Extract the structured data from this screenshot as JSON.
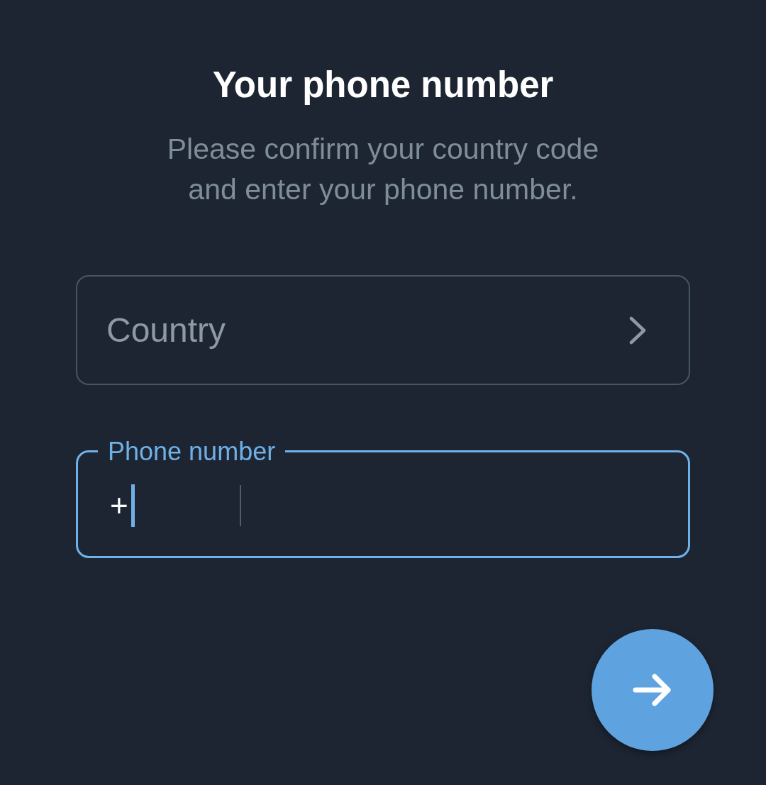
{
  "title": "Your phone number",
  "subtitle": "Please confirm your country code and enter your phone number.",
  "country_field": {
    "placeholder": "Country"
  },
  "phone_field": {
    "label": "Phone number",
    "focused": true,
    "country_code": {
      "value": "+"
    }
  }
}
